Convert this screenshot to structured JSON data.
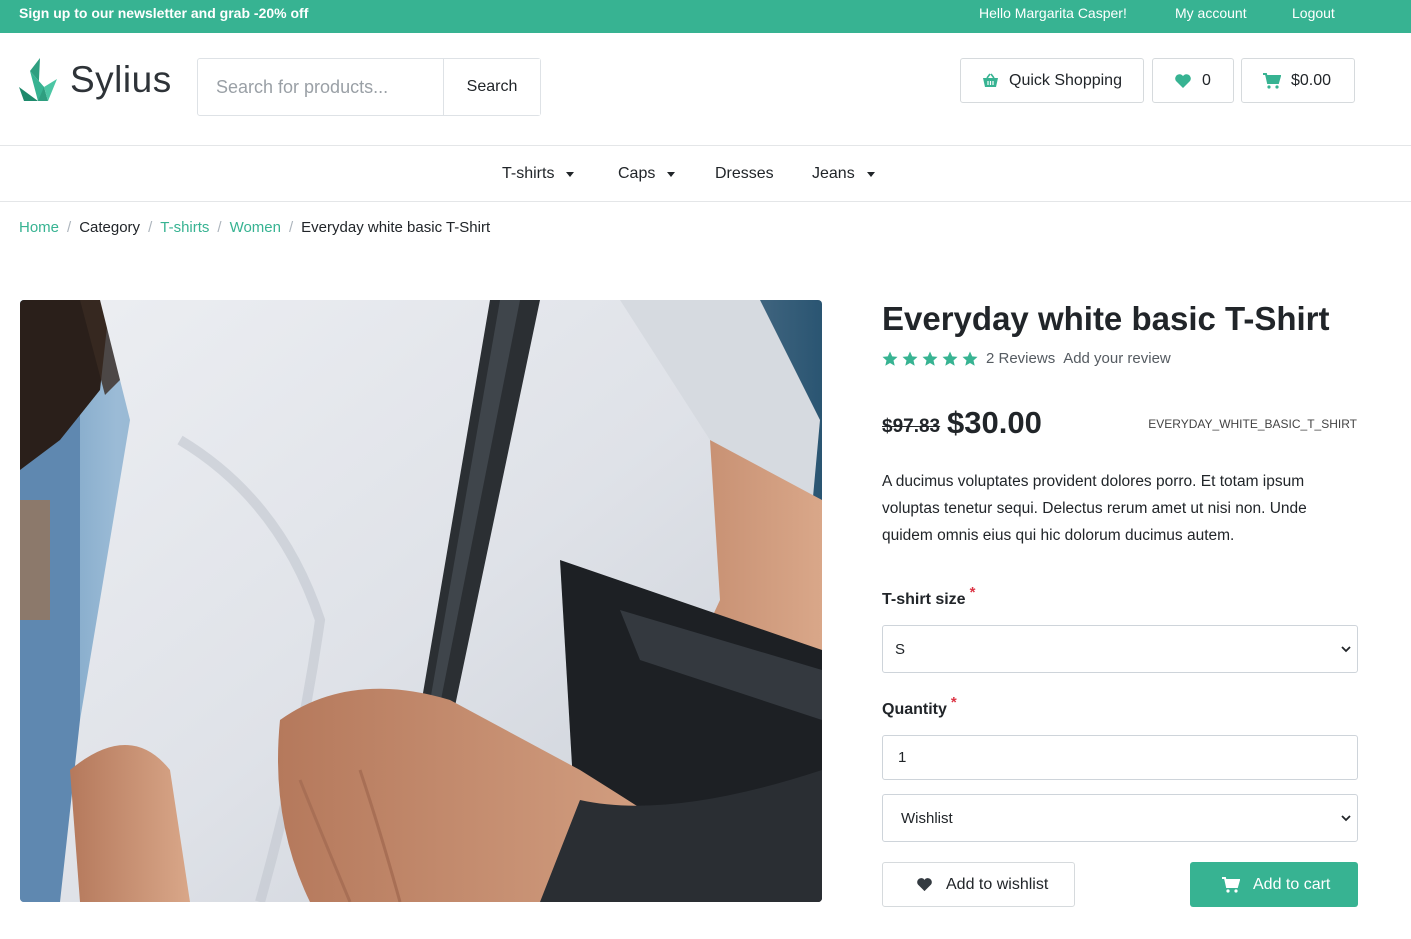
{
  "topbar": {
    "promo": "Sign up to our newsletter and grab -20% off",
    "greeting": "Hello Margarita Casper!",
    "my_account": "My account",
    "logout": "Logout"
  },
  "brand": {
    "name": "Sylius",
    "accent": "#37b392"
  },
  "search": {
    "placeholder": "Search for products...",
    "button": "Search"
  },
  "header_buttons": {
    "quick_shopping": "Quick Shopping",
    "wishlist_count": "0",
    "cart_total": "$0.00"
  },
  "nav": {
    "items": [
      {
        "label": "T-shirts",
        "has_dropdown": true
      },
      {
        "label": "Caps",
        "has_dropdown": true
      },
      {
        "label": "Dresses",
        "has_dropdown": false
      },
      {
        "label": "Jeans",
        "has_dropdown": true
      }
    ]
  },
  "breadcrumb": [
    "Home",
    "Category",
    "T-shirts",
    "Women",
    "Everyday white basic T-Shirt"
  ],
  "product": {
    "title": "Everyday white basic T-Shirt",
    "stars": 5,
    "reviews": "2 Reviews",
    "add_review": "Add your review",
    "old_price": "$97.83",
    "price": "$30.00",
    "code": "EVERYDAY_WHITE_BASIC_T_SHIRT",
    "description": "A ducimus voluptates provident dolores porro. Et totam ipsum voluptas tenetur sequi. Delectus rerum amet ut nisi non. Unde quidem omnis eius qui hic dolorum ducimus autem."
  },
  "form": {
    "size_label": "T-shirt size",
    "size_value": "S",
    "quantity_label": "Quantity",
    "quantity_value": "1",
    "wishlist_select": "Wishlist",
    "required_mark": "*"
  },
  "actions": {
    "add_to_wishlist": "Add to wishlist",
    "add_to_cart": "Add to cart"
  }
}
